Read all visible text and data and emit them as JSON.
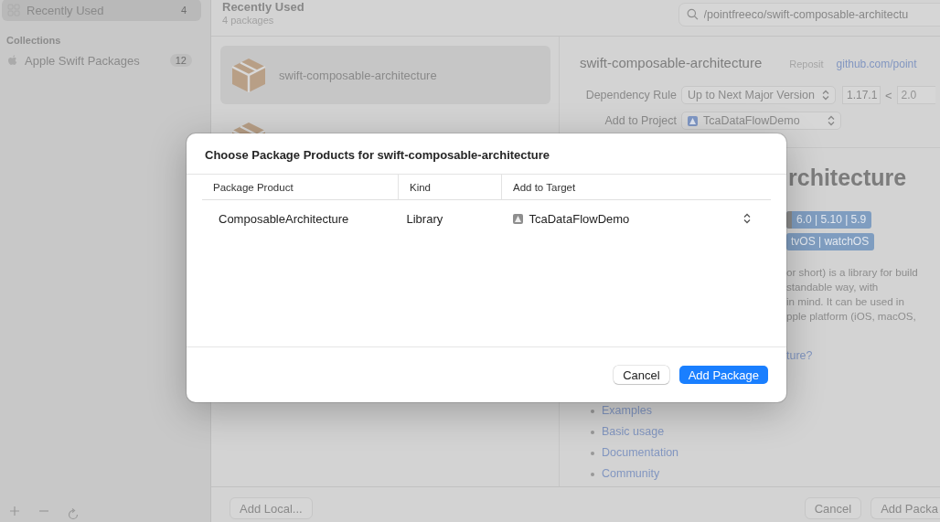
{
  "sidebar": {
    "items": [
      {
        "label": "Recently Used",
        "count": "4",
        "selected": true,
        "kind": "grid"
      }
    ],
    "sections": [
      {
        "title": "Collections",
        "items": [
          {
            "label": "Apple Swift Packages",
            "count": "12",
            "selected": false,
            "kind": "apple"
          }
        ]
      }
    ]
  },
  "header": {
    "title": "Recently Used",
    "subtitle": "4 packages",
    "search": {
      "value": "/pointfreeco/swift-composable-architectu"
    }
  },
  "packages": [
    {
      "name": "swift-composable-architecture",
      "selected": true
    },
    {
      "selected": false
    }
  ],
  "detail": {
    "name": "swift-composable-architecture",
    "repo_label": "Reposit",
    "repo_link": "github.com/point",
    "dependency_rule": {
      "label": "Dependency Rule",
      "value": "Up to Next Major Version",
      "from": "1.17.1",
      "separator": "<",
      "to": "2.0"
    },
    "project": {
      "label": "Add to Project",
      "value": "TcaDataFlowDemo"
    },
    "heading": "rchitecture",
    "badges": [
      {
        "text": "6.0 | 5.10 | 5.9",
        "label_part": true
      },
      {
        "text": "tvOS | watchOS",
        "label_part": false
      }
    ],
    "paragraph": [
      "or short) is a library for build",
      "standable way, with",
      "in mind. It can be used in",
      "pple platform (iOS, macOS,"
    ],
    "question_link": "ture?",
    "links": [
      "Examples",
      "Basic usage",
      "Documentation",
      "Community"
    ]
  },
  "bottom_bar": {
    "left": "Add Local...",
    "right": [
      "Cancel",
      "Add Packa"
    ]
  },
  "dialog": {
    "title": "Choose Package Products for swift-composable-architecture",
    "columns": [
      "Package Product",
      "Kind",
      "Add to Target"
    ],
    "rows": [
      {
        "product": "ComposableArchitecture",
        "kind": "Library",
        "target": "TcaDataFlowDemo"
      }
    ],
    "buttons": [
      {
        "label": "Cancel",
        "kind": "secondary"
      },
      {
        "label": "Add Package",
        "kind": "primary"
      }
    ]
  }
}
